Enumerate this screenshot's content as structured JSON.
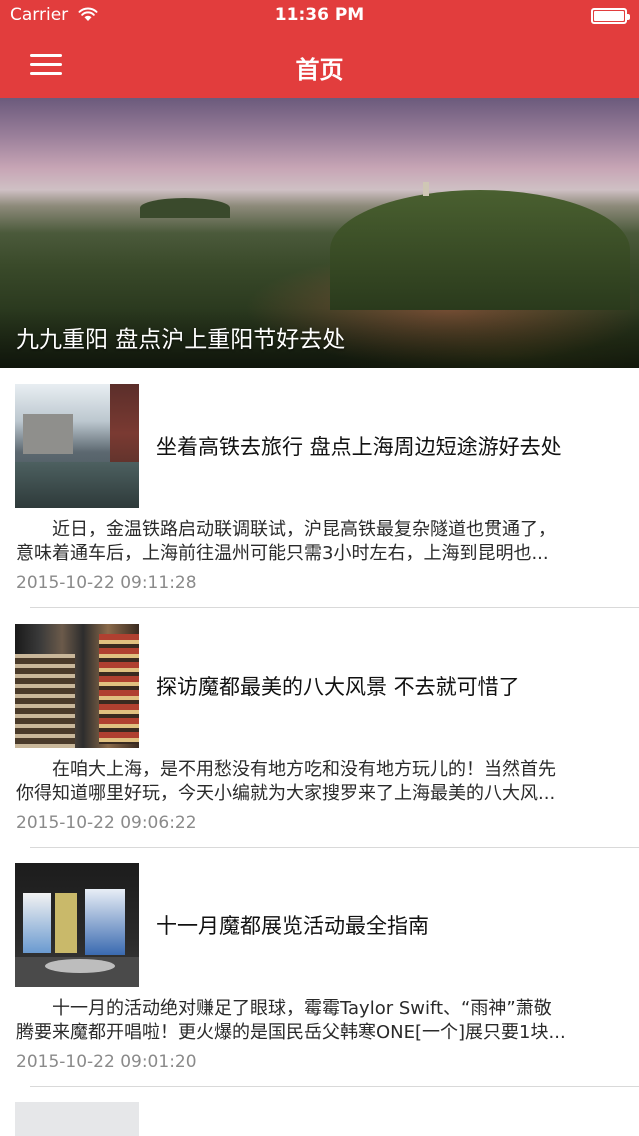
{
  "status_bar": {
    "carrier": "Carrier",
    "time": "11:36 PM",
    "wifi_icon": "wifi-icon",
    "battery_icon": "battery-icon",
    "battery_level": 1.0
  },
  "nav_bar": {
    "title": "首页",
    "menu_icon": "hamburger-menu-icon",
    "color": "#e23d3d"
  },
  "hero": {
    "caption": "九九重阳 盘点沪上重阳节好去处"
  },
  "articles": [
    {
      "title": "坐着高铁去旅行 盘点上海周边短途游好去处",
      "summary_line1": "近日，金温铁路启动联调联试，沪昆高铁最复杂隧道也贯通了，",
      "summary_line2": "意味着通车后，上海前往温州可能只需3小时左右，上海到昆明也...",
      "date": "2015-10-22 09:11:28"
    },
    {
      "title": "探访魔都最美的八大风景 不去就可惜了",
      "summary_line1": "在咱大上海，是不用愁没有地方吃和没有地方玩儿的！当然首先",
      "summary_line2": "你得知道哪里好玩，今天小编就为大家搜罗来了上海最美的八大风...",
      "date": "2015-10-22 09:06:22"
    },
    {
      "title": "十一月魔都展览活动最全指南",
      "summary_line1": "十一月的活动绝对赚足了眼球，霉霉Taylor Swift、“雨神”萧敬",
      "summary_line2": "腾要来魔都开唱啦！更火爆的是国民岳父韩寒ONE[一个]展只要1块...",
      "date": "2015-10-22 09:01:20"
    }
  ]
}
